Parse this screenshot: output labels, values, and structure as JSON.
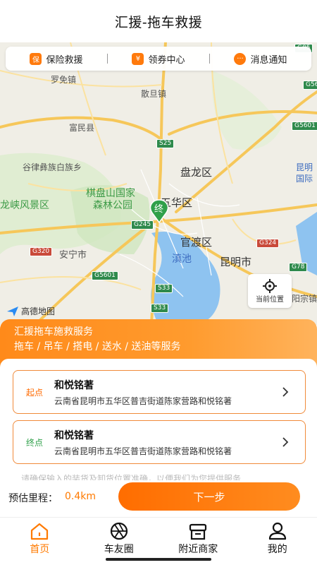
{
  "header": {
    "title": "汇援-拖车救援"
  },
  "shortcuts": [
    {
      "label": "保险救援",
      "icon": "shield-icon"
    },
    {
      "label": "领券中心",
      "icon": "coupon-icon"
    },
    {
      "label": "消息通知",
      "icon": "message-icon"
    }
  ],
  "map": {
    "pin_label": "终",
    "labels": {
      "luoyan": "罗免镇",
      "sandan": "散旦镇",
      "fumin": "富民县",
      "guyi": "谷律彝族白族乡",
      "panlong": "盘龙区",
      "qipan": "棋盘山国家",
      "forest": "森林公园",
      "wuhua": "五华区",
      "longxia": "龙峡风景区",
      "guandu": "官渡区",
      "dianchi": "滇池",
      "kunming": "昆明市",
      "anning": "安宁市",
      "airport1": "昆明",
      "airport2": "国际",
      "zongzhen": "阳宗镇"
    },
    "shields": {
      "g85": "G85",
      "s25": "S25",
      "g5601a": "G5601",
      "g245": "G245",
      "g320": "G320",
      "g5601b": "G5601",
      "s33a": "S33",
      "s33b": "S33",
      "g324": "G324",
      "g78": "G78",
      "g56": "G56"
    },
    "locate_label": "当前位置",
    "attribution": "高德地图"
  },
  "banner": {
    "line1": "汇援拖车施救服务",
    "line2": "拖车 / 吊车 / 搭电 / 送水 / 送油等服务"
  },
  "start": {
    "tag": "起点",
    "name": "和悦铭著",
    "address": "云南省昆明市五华区普吉街道陈家营路和悦铭著"
  },
  "end": {
    "tag": "终点",
    "name": "和悦铭著",
    "address": "云南省昆明市五华区普吉街道陈家营路和悦铭著"
  },
  "tip": "请确保输入的装货及卸货位置准确，以便我们为您提供服务",
  "estimate": {
    "label": "预估里程：",
    "value": "0.4km"
  },
  "next_button": "下一步",
  "tabs": [
    {
      "label": "首页",
      "icon": "home-icon",
      "active": true
    },
    {
      "label": "车友圈",
      "icon": "aperture-icon",
      "active": false
    },
    {
      "label": "附近商家",
      "icon": "store-icon",
      "active": false
    },
    {
      "label": "我的",
      "icon": "user-icon",
      "active": false
    }
  ],
  "colors": {
    "accent": "#ff7a00",
    "end_green": "#2fa04a",
    "road": "#f7c35c"
  }
}
